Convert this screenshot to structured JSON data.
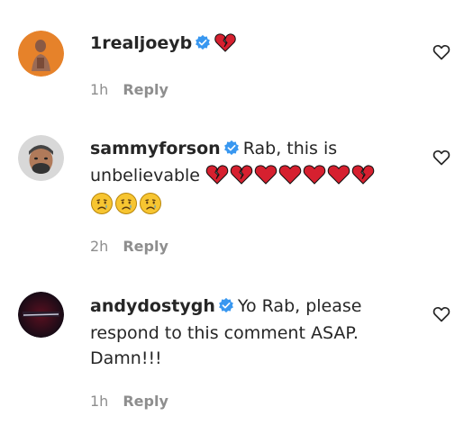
{
  "comments": [
    {
      "username": "1realjoeyb",
      "verified": true,
      "text": "",
      "emojis": [
        "broken-heart"
      ],
      "time": "1h",
      "reply_label": "Reply"
    },
    {
      "username": "sammyforson",
      "verified": true,
      "text": "Rab, this is unbelievable",
      "emojis": [
        "broken-heart",
        "broken-heart",
        "heart",
        "heart",
        "heart",
        "heart",
        "broken-heart",
        "crying-face",
        "crying-face",
        "crying-face"
      ],
      "time": "2h",
      "reply_label": "Reply"
    },
    {
      "username": "andydostygh",
      "verified": true,
      "text": "Yo Rab, please respond to this comment ASAP. Damn!!!",
      "emojis": [],
      "time": "1h",
      "reply_label": "Reply"
    }
  ],
  "colors": {
    "primary_text": "#262626",
    "secondary_text": "#8e8e8e",
    "verified_badge": "#3897f0",
    "heart_red": "#d6202f"
  },
  "icons": {
    "like": "heart-outline-icon",
    "verified": "verified-badge-icon"
  }
}
